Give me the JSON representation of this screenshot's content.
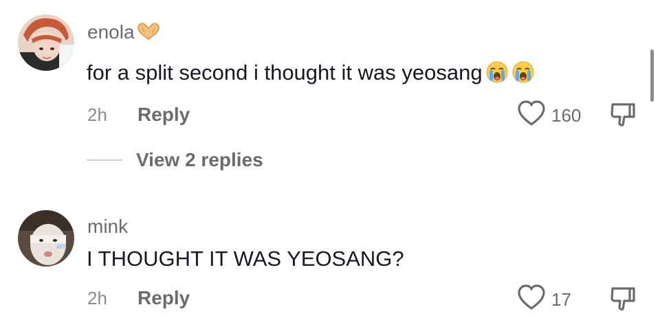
{
  "comments": [
    {
      "username": "enola",
      "username_emoji": "heart-hands",
      "text": "for a split second i thought it was yeosang",
      "text_emojis": [
        "loudly-crying-face",
        "loudly-crying-face"
      ],
      "time": "2h",
      "reply_label": "Reply",
      "likes": "160",
      "view_replies_label": "View 2 replies"
    },
    {
      "username": "mink",
      "text": "I THOUGHT IT WAS YEOSANG?",
      "time": "2h",
      "reply_label": "Reply",
      "likes": "17"
    }
  ],
  "icons": {
    "like": "heart-outline-icon",
    "dislike": "thumbs-down-icon"
  },
  "colors": {
    "text_primary": "#161823",
    "text_secondary": "#6b6b6b",
    "text_muted": "#8a8b91"
  }
}
